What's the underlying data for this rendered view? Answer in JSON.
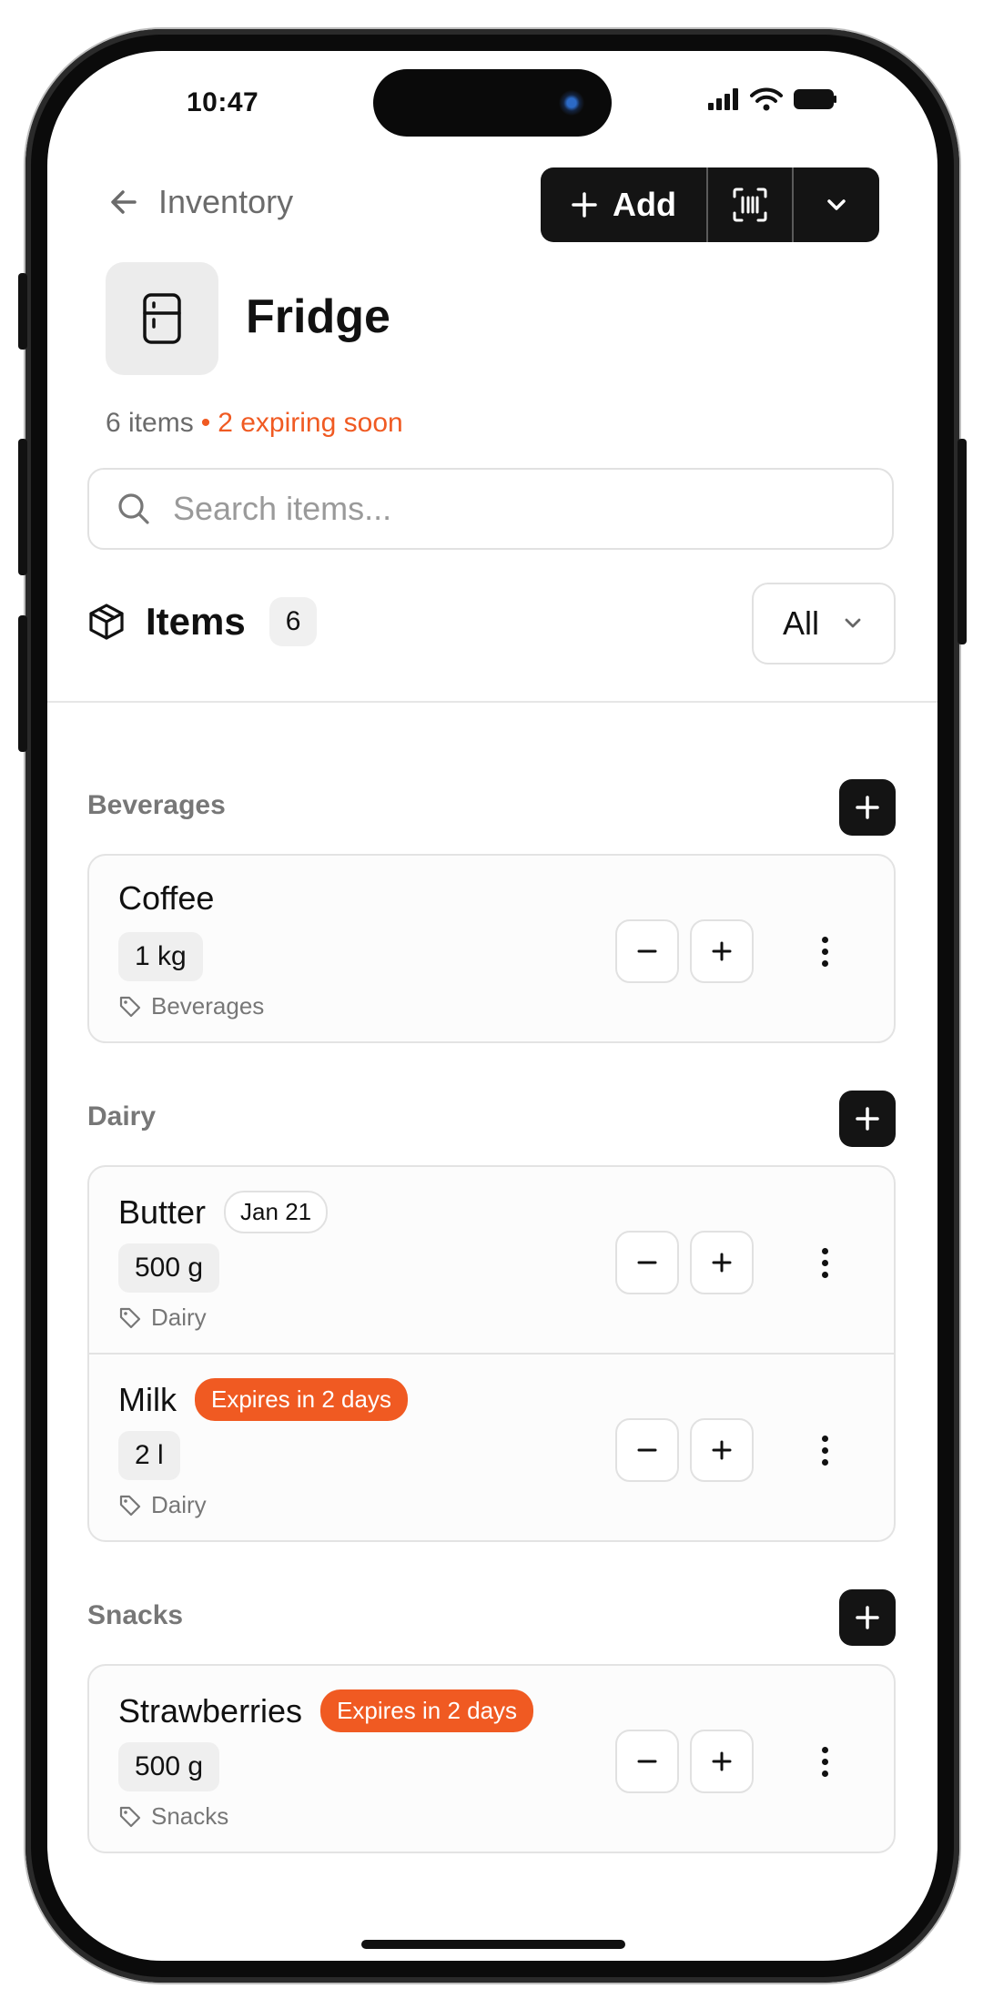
{
  "status": {
    "time": "10:47"
  },
  "header": {
    "back_label": "Inventory",
    "add_label": "Add",
    "title": "Fridge",
    "items_count_text": "6 items",
    "expiring_text": "2 expiring soon"
  },
  "search": {
    "placeholder": "Search items..."
  },
  "items_section": {
    "title": "Items",
    "count": "6",
    "filter": "All"
  },
  "groups": [
    {
      "label": "Beverages",
      "items": [
        {
          "name": "Coffee",
          "quantity": "1 kg",
          "category": "Beverages"
        }
      ]
    },
    {
      "label": "Dairy",
      "items": [
        {
          "name": "Butter",
          "date_badge": "Jan 21",
          "quantity": "500 g",
          "category": "Dairy"
        },
        {
          "name": "Milk",
          "expiry_badge": "Expires in 2 days",
          "quantity": "2 l",
          "category": "Dairy"
        }
      ]
    },
    {
      "label": "Snacks",
      "items": [
        {
          "name": "Strawberries",
          "expiry_badge": "Expires in 2 days",
          "quantity": "500 g",
          "category": "Snacks"
        }
      ]
    }
  ],
  "colors": {
    "accent": "#f05a22",
    "dark": "#141414"
  },
  "icons": [
    "back-arrow-icon",
    "plus-icon",
    "barcode-scan-icon",
    "chevron-down-icon",
    "fridge-icon",
    "search-icon",
    "package-icon",
    "tag-icon",
    "minus-icon",
    "more-vertical-icon"
  ]
}
